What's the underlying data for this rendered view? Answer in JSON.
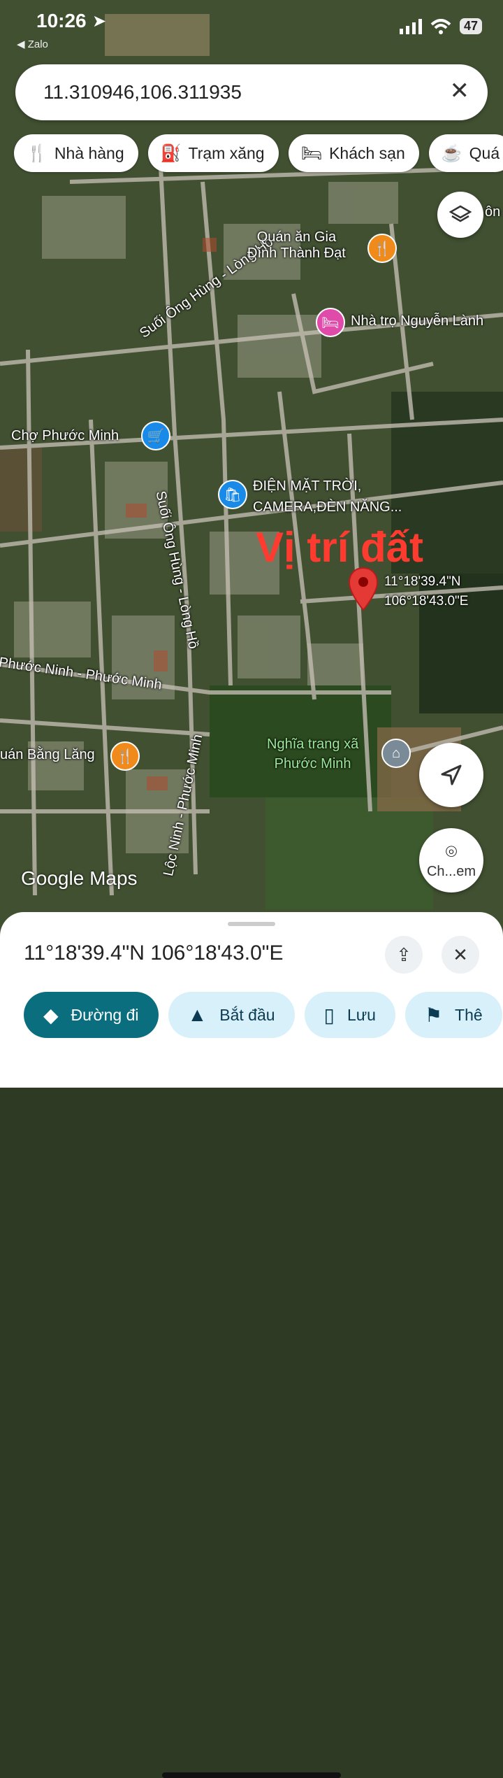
{
  "status": {
    "time": "10:26",
    "back_app": "Zalo",
    "battery": "47"
  },
  "search": {
    "query": "11.310946,106.311935"
  },
  "chips": [
    {
      "icon": "restaurant-icon",
      "label": "Nhà hàng"
    },
    {
      "icon": "gas-station-icon",
      "label": "Trạm xăng"
    },
    {
      "icon": "bed-icon",
      "label": "Khách sạn"
    },
    {
      "icon": "cafe-icon",
      "label": "Quá"
    }
  ],
  "map": {
    "labels": {
      "poi_quan_an": "Quán ăn Gia\nĐình Thành Đạt",
      "poi_nha_tro": "Nhà trọ Nguyễn Lành",
      "poi_cho": "Chợ Phước Minh",
      "poi_dien": "ĐIỆN MẶT TRỜI,\nCAMERA,ĐÈN NĂNG...",
      "poi_nghia_trang": "Nghĩa trang xã\nPhước Minh",
      "poi_bang_lang": "uán Bằng Lăng",
      "road_1": "Suối Ông Hùng - Lòng Hồ",
      "road_2": "Suối Ông Hùng - Lòng Hồ",
      "road_3": "Phước Ninh - Phước Minh",
      "road_4": "Lộc Ninh - Phước Minh",
      "edge_label": "ôn"
    },
    "overlay_text": "Vị trí đất",
    "pin_lat": "11°18'39.4\"N",
    "pin_lng": "106°18'43.0\"E",
    "watermark": "Google Maps",
    "camera_label": "Ch...em"
  },
  "sheet": {
    "coords": "11°18'39.4\"N 106°18'43.0\"E",
    "actions": [
      {
        "icon": "directions-icon",
        "label": "Đường đi"
      },
      {
        "icon": "navigation-icon",
        "label": "Bắt đầu"
      },
      {
        "icon": "bookmark-icon",
        "label": "Lưu"
      },
      {
        "icon": "flag-icon",
        "label": "Thê"
      }
    ]
  }
}
